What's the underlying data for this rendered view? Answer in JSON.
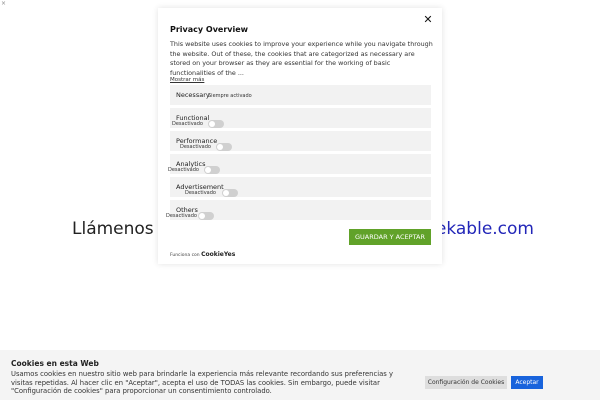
{
  "page": {
    "corner_mark": "×",
    "behind_left": "Llámenos al",
    "behind_right": "rekable.com"
  },
  "modal": {
    "close_glyph": "✕",
    "title": "Privacy Overview",
    "description": "This website uses cookies to improve your experience while you navigate through the website. Out of these, the cookies that are categorized as necessary are stored on your browser as they are essential for the working of basic functionalities of the ...",
    "show_more": "Mostrar más",
    "categories": [
      {
        "name": "Necessary",
        "status": "Siempre activado"
      },
      {
        "name": "Functional",
        "status": "Desactivado"
      },
      {
        "name": "Performance",
        "status": "Desactivado"
      },
      {
        "name": "Analytics",
        "status": "Desactivado"
      },
      {
        "name": "Advertisement",
        "status": "Desactivado"
      },
      {
        "name": "Others",
        "status": "Desactivado"
      }
    ],
    "accept_button": "GUARDAR Y ACEPTAR",
    "powered_prefix": "Funciona con",
    "powered_brand": "CookieYes"
  },
  "cookie_bar": {
    "title": "Cookies en esta Web",
    "text": "Usamos cookies en nuestro sitio web para brindarle la experiencia más relevante recordando sus preferencias y visitas repetidas. Al hacer clic en \"Aceptar\", acepta el uso de TODAS las cookies. Sin embargo, puede visitar \"Configuración de cookies\" para proporcionar un consentimiento controlado.",
    "config_button": "Configuración de Cookies",
    "accept_button": "Aceptar"
  },
  "colors": {
    "accent_green": "#61a229",
    "accent_blue": "#1863dc",
    "link_blue": "#2226b8"
  }
}
